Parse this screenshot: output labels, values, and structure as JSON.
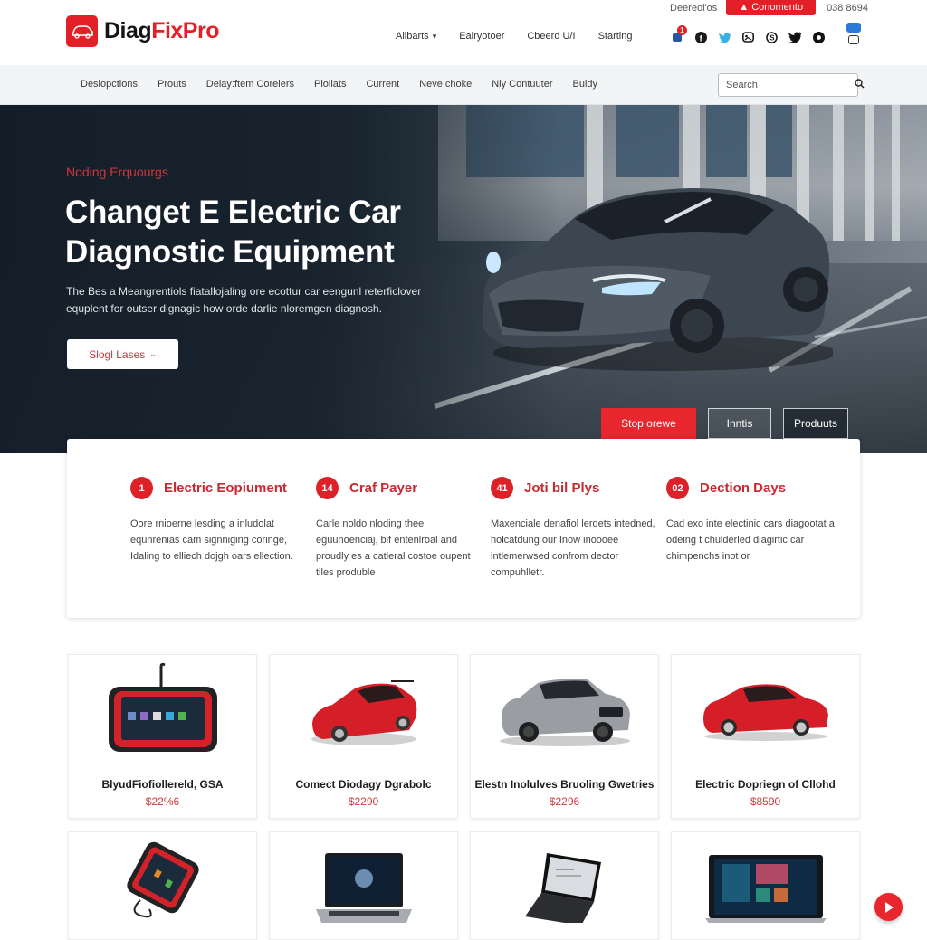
{
  "brand": {
    "name_part1": "Diag",
    "name_part2": "FixPro",
    "accent": "#e32028"
  },
  "utility": {
    "link": "Deereol'os",
    "cta": "▲ Conomento",
    "phone": "038 8694"
  },
  "main_nav": [
    {
      "label": "Allbarts",
      "has_dropdown": true
    },
    {
      "label": "Ealryotoer",
      "has_dropdown": false
    },
    {
      "label": "Cbeerd U/I",
      "has_dropdown": false
    },
    {
      "label": "Starting",
      "has_dropdown": false
    }
  ],
  "socials": {
    "notification_count": "1",
    "icons": [
      "notification-icon",
      "facebook-icon",
      "twitter-icon",
      "gallery-icon",
      "skype-icon",
      "twitter-bird-icon",
      "record-icon"
    ]
  },
  "sub_nav": {
    "links": [
      "Desiopctions",
      "Prouts",
      "Delay:ftem Corelers",
      "Piollats",
      "Current",
      "Neve choke",
      "Nly Contuuter",
      "Buidy"
    ],
    "search_placeholder": "Search"
  },
  "hero": {
    "kicker": "Noding Erquourgs",
    "title_line1": "Changet E Electric Car",
    "title_line2": "Diagnostic Equipment",
    "description": "The Bes a Meangrentiols fiatallojaling ore ecottur car eengunl reterficlover equplent for outser dignagic how orde darlie nloremgen diagnosh.",
    "select_label": "Slogl Lases",
    "buttons": [
      "Stop orewe",
      "Inntis",
      "Produuts"
    ]
  },
  "features": [
    {
      "num": "1",
      "title": "Electric Eopiument",
      "body": "Oore rnioerne lesding a inludolat equnrenias cam signniging coringe, Idaling to elliech dojgh oars ellection."
    },
    {
      "num": "14",
      "title": "Craf Payer",
      "body": "Carle noldo nloding thee eguunoenciaj, bif entenlroal and proudly es a catleral costoe oupent tiles produble"
    },
    {
      "num": "41",
      "title": "Joti bil Plys",
      "body": "Maxenciale denafiol lerdets intedned, holcatdung our Inow inoooee intlemerwsed confrom dector compuhlletr."
    },
    {
      "num": "02",
      "title": "Dection Days",
      "body": "Cad exo inte electinic cars diagootat a odeing t chulderled diagirtic car chimpenchs inot or"
    }
  ],
  "products": [
    {
      "name": "BlyudFiofiollereld, GSA",
      "price": "$22%6",
      "image": "diagnostic-tablet-red"
    },
    {
      "name": "Comect Diodagy Dgrabolc",
      "price": "$2290",
      "image": "red-coupe"
    },
    {
      "name": "Elestn Inolulves Bruoling Gwetries",
      "price": "$2296",
      "image": "silver-suv"
    },
    {
      "name": "Electric Dopriegn of Cllohd",
      "price": "$8590",
      "image": "red-sedan"
    },
    {
      "name": "",
      "price": "",
      "image": "diagnostic-scanner-cable"
    },
    {
      "name": "",
      "price": "",
      "image": "laptop-dark-wallpaper"
    },
    {
      "name": "",
      "price": "",
      "image": "laptop-black-open"
    },
    {
      "name": "",
      "price": "",
      "image": "laptop-media-app"
    }
  ]
}
